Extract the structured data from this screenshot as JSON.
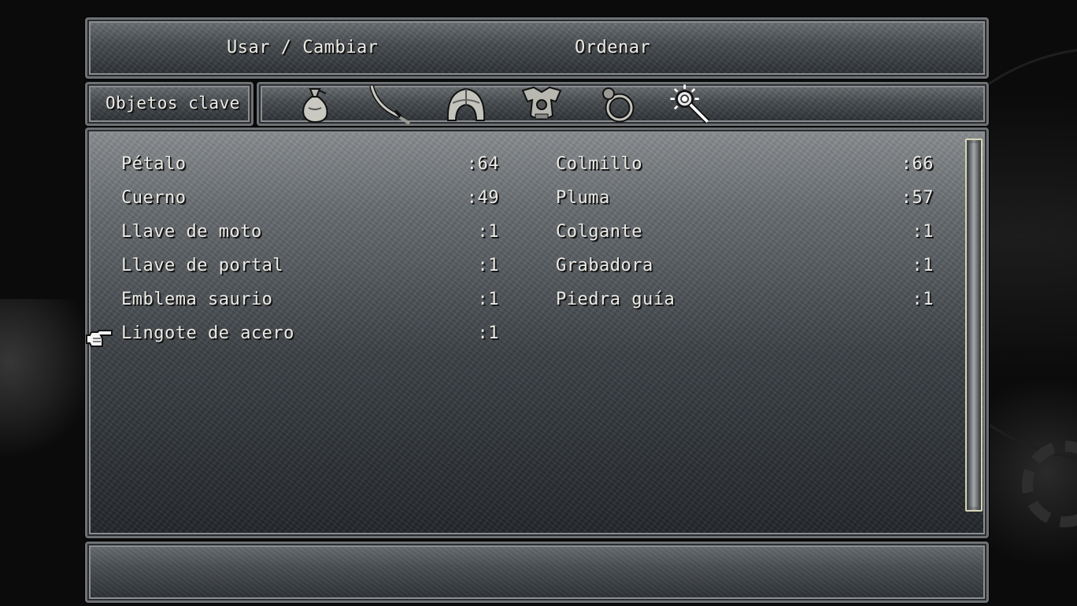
{
  "menu": {
    "use_change": "Usar / Cambiar",
    "sort": "Ordenar"
  },
  "category": {
    "label": "Objetos clave"
  },
  "tabs": [
    {
      "icon": "item-bag-icon"
    },
    {
      "icon": "sword-icon"
    },
    {
      "icon": "helmet-icon"
    },
    {
      "icon": "armor-icon"
    },
    {
      "icon": "ring-icon"
    },
    {
      "icon": "key-item-magnifier-icon",
      "selected": true
    }
  ],
  "items": {
    "left": [
      {
        "name": "Pétalo",
        "qty": ":64"
      },
      {
        "name": "Cuerno",
        "qty": ":49"
      },
      {
        "name": "Llave de moto",
        "qty": ":1"
      },
      {
        "name": "Llave de portal",
        "qty": ":1"
      },
      {
        "name": "Emblema saurio",
        "qty": ":1"
      },
      {
        "name": "Lingote de acero",
        "qty": ":1"
      }
    ],
    "right": [
      {
        "name": "Colmillo",
        "qty": ":66"
      },
      {
        "name": "Pluma",
        "qty": ":57"
      },
      {
        "name": "Colgante",
        "qty": ":1"
      },
      {
        "name": "Grabadora",
        "qty": ":1"
      },
      {
        "name": "Piedra guía",
        "qty": ":1"
      }
    ]
  },
  "selected_item": "Lingote de acero",
  "description": ""
}
